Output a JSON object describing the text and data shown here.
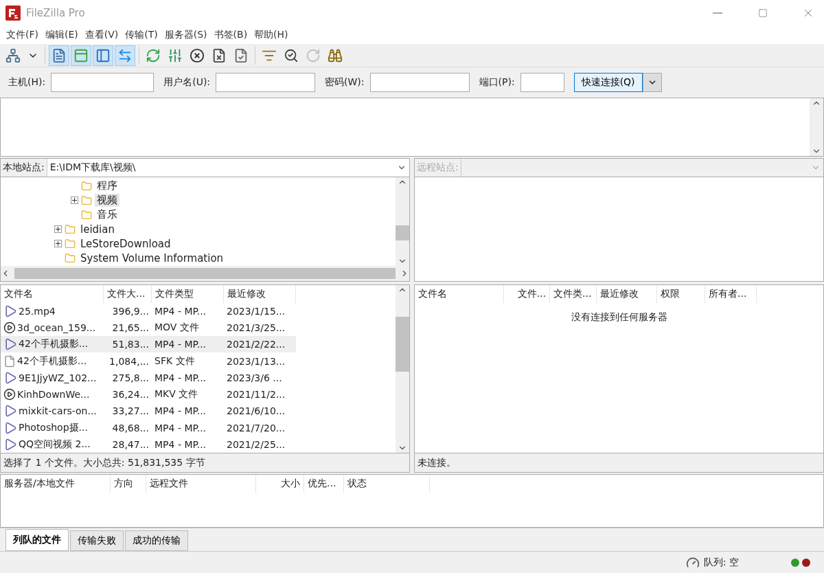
{
  "window": {
    "title": "FileZilla Pro"
  },
  "menu": [
    "文件(F)",
    "编辑(E)",
    "查看(V)",
    "传输(T)",
    "服务器(S)",
    "书签(B)",
    "帮助(H)"
  ],
  "toolbar": [
    {
      "kind": "site-manager",
      "selected": false,
      "disabled": false
    },
    {
      "kind": "dropdown",
      "selected": false,
      "disabled": false
    },
    {
      "kind": "log",
      "selected": true,
      "disabled": false
    },
    {
      "kind": "local-tree",
      "selected": true,
      "disabled": false
    },
    {
      "kind": "remote-tree",
      "selected": true,
      "disabled": false
    },
    {
      "kind": "queue",
      "selected": true,
      "disabled": false
    },
    {
      "kind": "refresh",
      "selected": false,
      "disabled": false
    },
    {
      "kind": "filters",
      "selected": false,
      "disabled": false
    },
    {
      "kind": "cancel",
      "selected": false,
      "disabled": false
    },
    {
      "kind": "disconnect",
      "selected": false,
      "disabled": false
    },
    {
      "kind": "reconnect-file",
      "selected": false,
      "disabled": false
    },
    {
      "kind": "compare",
      "selected": false,
      "disabled": false
    },
    {
      "kind": "search",
      "selected": false,
      "disabled": false
    },
    {
      "kind": "sync",
      "selected": false,
      "disabled": true
    },
    {
      "kind": "find",
      "selected": false,
      "disabled": false
    }
  ],
  "quickconnect": {
    "fields": [
      {
        "label": "主机(H):"
      },
      {
        "label": "用户名(U):"
      },
      {
        "label": "密码(W):"
      },
      {
        "label": "端口(P):"
      }
    ],
    "button": "快速连接(Q)"
  },
  "local": {
    "site_label": "本地站点:",
    "path": "E:\\IDM下载库\\视频\\",
    "tree": [
      {
        "children": [
          {
            "label": "程序",
            "expandable": false,
            "selected": false
          },
          {
            "label": "视频",
            "expandable": true,
            "selected": true
          },
          {
            "label": "音乐",
            "expandable": false,
            "selected": false
          }
        ]
      },
      {
        "label": "leidian",
        "expandable": true,
        "selected": false
      },
      {
        "label": "LeStoreDownload",
        "expandable": true,
        "selected": false
      },
      {
        "label": "System Volume Information",
        "expandable": false,
        "selected": false
      }
    ],
    "columns": [
      "文件名",
      "文件大...",
      "文件类型",
      "最近修改"
    ],
    "rows": [
      {
        "kind": "video",
        "selected": false,
        "cells": [
          "25.mp4",
          "396,9...",
          "MP4 - MP...",
          "2023/1/15..."
        ]
      },
      {
        "kind": "media",
        "selected": false,
        "cells": [
          "3d_ocean_159...",
          "21,65...",
          "MOV 文件",
          "2021/3/25..."
        ]
      },
      {
        "kind": "video",
        "selected": true,
        "cells": [
          "42个手机摄影...",
          "51,83...",
          "MP4 - MP...",
          "2021/2/22..."
        ]
      },
      {
        "kind": "file",
        "selected": false,
        "cells": [
          "42个手机摄影...",
          "1,084,...",
          "SFK 文件",
          "2023/1/13..."
        ]
      },
      {
        "kind": "video",
        "selected": false,
        "cells": [
          "9E1JjyWZ_102...",
          "275,8...",
          "MP4 - MP...",
          "2023/3/6 ..."
        ]
      },
      {
        "kind": "media",
        "selected": false,
        "cells": [
          "KinhDownWe...",
          "36,24...",
          "MKV 文件",
          "2021/11/2..."
        ]
      },
      {
        "kind": "video",
        "selected": false,
        "cells": [
          "mixkit-cars-on...",
          "33,27...",
          "MP4 - MP...",
          "2021/6/10..."
        ]
      },
      {
        "kind": "video",
        "selected": false,
        "cells": [
          "Photoshop摄...",
          "48,68...",
          "MP4 - MP...",
          "2021/7/20..."
        ]
      },
      {
        "kind": "video",
        "selected": false,
        "cells": [
          "QQ空间视频 2...",
          "28,47...",
          "MP4 - MP...",
          "2021/2/25..."
        ]
      }
    ],
    "status": "选择了 1 个文件。大小总共: 51,831,535 字节"
  },
  "remote": {
    "site_label": "远程站点:",
    "disabled": true,
    "columns": [
      "文件名",
      "文件...",
      "文件类...",
      "最近修改",
      "权限",
      "所有者..."
    ],
    "message": "没有连接到任何服务器",
    "status": "未连接。"
  },
  "queue": {
    "columns": [
      "服务器/本地文件",
      "方向",
      "远程文件",
      "大小",
      "优先...",
      "状态"
    ],
    "tabs": [
      {
        "label": "列队的文件",
        "selected": true
      },
      {
        "label": "传输失败",
        "selected": false
      },
      {
        "label": "成功的传输",
        "selected": false
      }
    ]
  },
  "status_bar": {
    "queue": "队列: 空"
  }
}
